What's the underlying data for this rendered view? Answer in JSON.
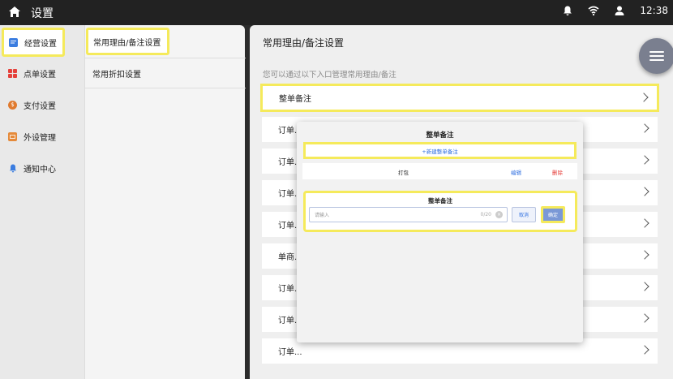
{
  "topbar": {
    "title": "设置",
    "time": "12:38"
  },
  "sidebar": {
    "items": [
      {
        "label": "经营设置",
        "color": "#3b7de0"
      },
      {
        "label": "点单设置",
        "color": "#e5403a"
      },
      {
        "label": "支付设置",
        "color": "#e07a2e"
      },
      {
        "label": "外设管理",
        "color": "#e58a3a"
      },
      {
        "label": "通知中心",
        "color": "#3b7de0"
      }
    ]
  },
  "subnav": {
    "items": [
      {
        "label": "常用理由/备注设置"
      },
      {
        "label": "常用折扣设置"
      }
    ]
  },
  "main": {
    "title": "常用理由/备注设置",
    "subtitle": "您可以通过以下入口管理常用理由/备注",
    "rows": [
      {
        "label": "整单备注"
      },
      {
        "label": "订单..."
      },
      {
        "label": "订单..."
      },
      {
        "label": "订单..."
      },
      {
        "label": "订单..."
      },
      {
        "label": "单商..."
      },
      {
        "label": "订单..."
      },
      {
        "label": "订单..."
      },
      {
        "label": "订单..."
      }
    ]
  },
  "modal": {
    "title": "整单备注",
    "add_label": "+新建整单备注",
    "items": [
      {
        "name": "打包",
        "edit": "编辑",
        "delete": "删除"
      }
    ],
    "inner": {
      "title": "整单备注",
      "placeholder": "请输入",
      "count": "0/20",
      "cancel": "取消",
      "confirm": "确定"
    }
  }
}
